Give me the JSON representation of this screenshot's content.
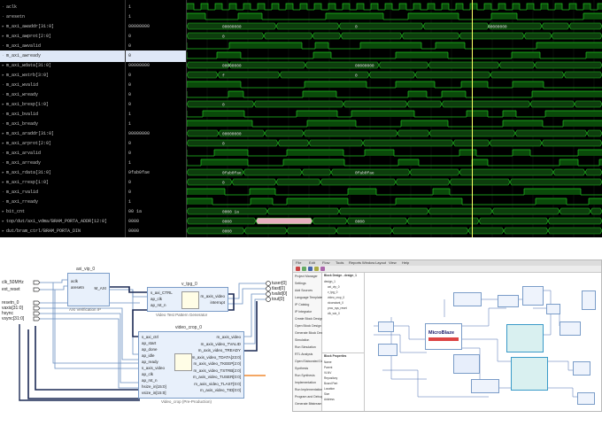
{
  "waveform": {
    "signals": [
      {
        "name": "aclk",
        "value": "1",
        "expandable": false
      },
      {
        "name": "aresetn",
        "value": "1",
        "expandable": false
      },
      {
        "name": "m_axi_awaddr[31:0]",
        "value": "00000000",
        "expandable": true
      },
      {
        "name": "m_axi_awprot[2:0]",
        "value": "0",
        "expandable": true
      },
      {
        "name": "m_axi_awvalid",
        "value": "0",
        "expandable": false
      },
      {
        "name": "m_axi_awready",
        "value": "0",
        "expandable": false
      },
      {
        "name": "m_axi_wdata[31:0]",
        "value": "00000000",
        "expandable": true
      },
      {
        "name": "m_axi_wstrb[3:0]",
        "value": "0",
        "expandable": true
      },
      {
        "name": "m_axi_wvalid",
        "value": "0",
        "expandable": false
      },
      {
        "name": "m_axi_wready",
        "value": "0",
        "expandable": false
      },
      {
        "name": "m_axi_bresp[1:0]",
        "value": "0",
        "expandable": true
      },
      {
        "name": "m_axi_bvalid",
        "value": "1",
        "expandable": false
      },
      {
        "name": "m_axi_bready",
        "value": "1",
        "expandable": false
      },
      {
        "name": "m_axi_araddr[31:0]",
        "value": "00000000",
        "expandable": true
      },
      {
        "name": "m_axi_arprot[2:0]",
        "value": "0",
        "expandable": true
      },
      {
        "name": "m_axi_arvalid",
        "value": "0",
        "expandable": false
      },
      {
        "name": "m_axi_arready",
        "value": "1",
        "expandable": false
      },
      {
        "name": "m_axi_rdata[31:0]",
        "value": "0fab0fae",
        "expandable": true
      },
      {
        "name": "m_axi_rresp[1:0]",
        "value": "0",
        "expandable": true
      },
      {
        "name": "m_axi_rvalid",
        "value": "0",
        "expandable": false
      },
      {
        "name": "m_axi_rready",
        "value": "1",
        "expandable": false
      },
      {
        "name": "bit_cnt",
        "value": "00 1a",
        "expandable": true
      },
      {
        "name": "top/dut/axi_vdma/BRAM_PORTA_ADDR[12:0]",
        "value": "0000",
        "expandable": true
      },
      {
        "name": "dut/bram_ctrl/BRAM_PORTA_DIN",
        "value": "0000",
        "expandable": true
      }
    ],
    "bus_labels": [
      {
        "row": 2,
        "texts": [
          "00000000",
          "0",
          "00000000"
        ]
      },
      {
        "row": 3,
        "texts": [
          "0"
        ]
      },
      {
        "row": 6,
        "texts": [
          "00000000",
          "00000000"
        ]
      },
      {
        "row": 7,
        "texts": [
          "f",
          "0"
        ]
      },
      {
        "row": 10,
        "texts": [
          "0"
        ]
      },
      {
        "row": 13,
        "texts": [
          "00000000"
        ]
      },
      {
        "row": 14,
        "texts": [
          "0"
        ]
      },
      {
        "row": 17,
        "texts": [
          "0fab0fae",
          "0fab0fae"
        ]
      },
      {
        "row": 18,
        "texts": [
          "0"
        ]
      },
      {
        "row": 21,
        "texts": [
          "0000 1a"
        ]
      },
      {
        "row": 22,
        "texts": [
          "0000",
          "0000"
        ]
      },
      {
        "row": 23,
        "texts": [
          "0000"
        ]
      }
    ],
    "selected_row": 5,
    "colors": {
      "wave": "#22c322",
      "bus_fill": "#0d3d0d",
      "cursor": "#ffff66",
      "highlight": "#e8b0c0"
    }
  },
  "block_diagram": {
    "inputs": [
      "clk_50MHz",
      "ext_reset",
      "resetn_0",
      "vaxis[31:0]",
      "hsync",
      "vsync[31:0]"
    ],
    "outputs": [
      "tuser[0]",
      "tlast[0]",
      "tvalid[0]",
      "tout[0]"
    ],
    "blocks": {
      "axi_vip": {
        "title": "axi_vip_0",
        "caption": "AXI Verification IP",
        "ports_left": [
          "aclk",
          "aresetn"
        ],
        "ports_right": [
          "M_AXI"
        ]
      },
      "tpg": {
        "title": "v_tpg_0",
        "caption": "Video Test Pattern Generator",
        "ports_left": [
          "s_axi_CTRL",
          "ap_clk",
          "ap_rst_n"
        ],
        "ports_right": [
          "m_axis_video",
          "interrupt"
        ]
      },
      "vcrop": {
        "title": "video_crop_0",
        "caption": "Video_crop (Pre-Production)",
        "ports_left": [
          "s_axi_ctrl",
          "ap_start",
          "ap_done",
          "ap_idle",
          "ap_ready",
          "s_axis_video",
          "ap_clk",
          "ap_rst_n",
          "hsize_in[15:0]",
          "vsize_in[15:0]"
        ],
        "ports_right": [
          "m_axis_video",
          "m_axis_video_TVALID",
          "m_axis_video_TREADY",
          "m_axis_video_TDATA[23:0]",
          "m_axis_video_TKEEP[2:0]",
          "m_axis_video_TSTRB[2:0]",
          "m_axis_video_TUSER[0:0]",
          "m_axis_video_TLAST[0:0]",
          "m_axis_video_TID[0:0]"
        ]
      }
    }
  },
  "vivado": {
    "menu": [
      "File",
      "Edit",
      "Flow",
      "Tools",
      "Reports",
      "Window",
      "Layout",
      "View",
      "Help"
    ],
    "flow_items": [
      "Project Manager",
      "Settings",
      "Add Sources",
      "Language Templates",
      "IP Catalog",
      "IP Integrator",
      "Create Block Design",
      "Open Block Design",
      "Generate Block Design",
      "Simulation",
      "Run Simulation",
      "RTL Analysis",
      "Open Elaborated Design",
      "Synthesis",
      "Run Synthesis",
      "Implementation",
      "Run Implementation",
      "Program and Debug",
      "Generate Bitstream"
    ],
    "sources_title": "Block Design - design_1",
    "tree": [
      "design_1",
      "axi_vip_0",
      "v_tpg_0",
      "video_crop_0",
      "xlconstant_0",
      "proc_sys_reset",
      "clk_wiz_0"
    ],
    "props_title": "Block Properties",
    "props": [
      "Name",
      "Parent",
      "VLNV",
      "Repository",
      "Board Part",
      "Location",
      "Size",
      "Address"
    ],
    "microblaze_label": "MicroBlaze"
  }
}
